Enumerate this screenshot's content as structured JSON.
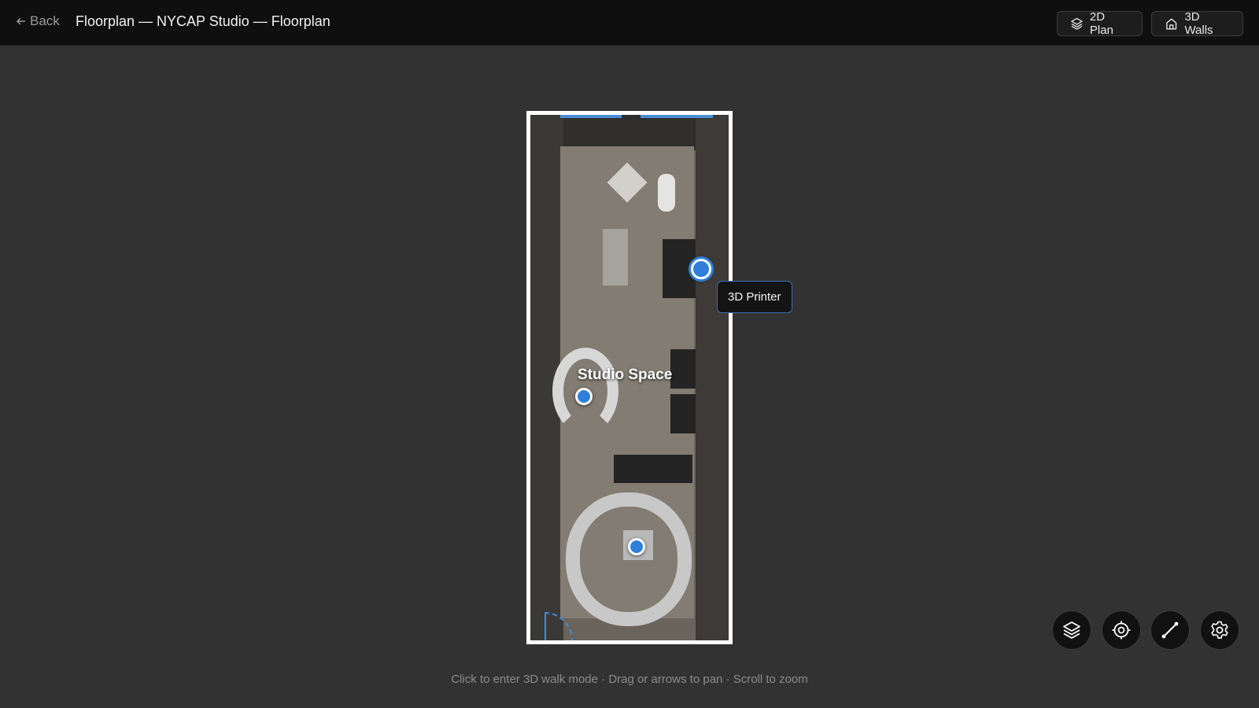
{
  "header": {
    "back_label": "Back",
    "title": "Floorplan — NYCAP Studio — Floorplan",
    "view_modes": [
      {
        "label": "2D Plan",
        "icon": "layers-icon"
      },
      {
        "label": "3D Walls",
        "icon": "home-icon"
      }
    ]
  },
  "plan": {
    "area_label": "Studio Space",
    "pins": [
      {
        "name": "3D Printer",
        "active": true
      },
      {
        "name": "studio-pin",
        "active": false
      },
      {
        "name": "lounge-pin",
        "active": false
      }
    ],
    "tooltip": "3D Printer"
  },
  "toolbar": {
    "tools": [
      {
        "icon": "layers-icon"
      },
      {
        "icon": "target-icon"
      },
      {
        "icon": "measure-icon"
      },
      {
        "icon": "gear-icon"
      }
    ]
  },
  "hint": "Click to enter 3D walk mode · Drag or arrows to pan · Scroll to zoom",
  "colors": {
    "background": "#323232",
    "topbar": "#0f0f0f",
    "accent": "#2f7fdb"
  }
}
